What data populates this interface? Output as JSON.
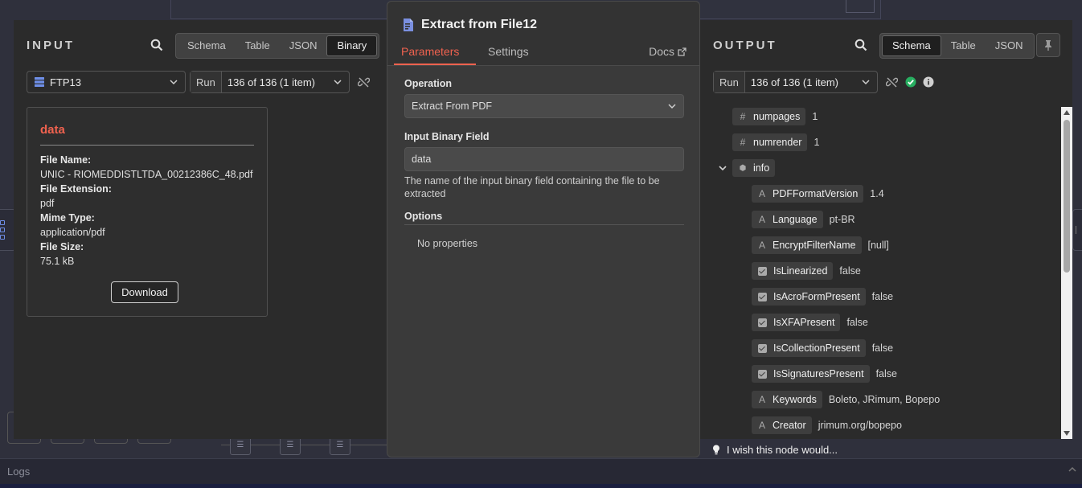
{
  "input": {
    "title": "INPUT",
    "view_tabs": [
      "Schema",
      "Table",
      "JSON",
      "Binary"
    ],
    "active_tab": "Binary",
    "source_node": "FTP13",
    "run_prefix": "Run",
    "run_select": "136 of 136 (1 item)",
    "binary": {
      "name": "data",
      "file_name_label": "File Name:",
      "file_name": "UNIC - RIOMEDDISTLTDA_00212386C_48.pdf",
      "file_extension_label": "File Extension:",
      "file_extension": "pdf",
      "mime_type_label": "Mime Type:",
      "mime_type": "application/pdf",
      "file_size_label": "File Size:",
      "file_size": "75.1 kB",
      "download_label": "Download"
    }
  },
  "node": {
    "title": "Extract from File12",
    "tabs": [
      "Parameters",
      "Settings"
    ],
    "active_tab": "Parameters",
    "docs_label": "Docs",
    "operation_label": "Operation",
    "operation_value": "Extract From PDF",
    "input_binary_label": "Input Binary Field",
    "input_binary_value": "data",
    "input_binary_hint": "The name of the input binary field containing the file to be extracted",
    "options_label": "Options",
    "no_properties": "No properties",
    "wish_text": "I wish this node would..."
  },
  "output": {
    "title": "OUTPUT",
    "view_tabs": [
      "Schema",
      "Table",
      "JSON"
    ],
    "active_tab": "Schema",
    "run_prefix": "Run",
    "run_select": "136 of 136 (1 item)",
    "rows": [
      {
        "type": "#",
        "key": "numpages",
        "value": "1",
        "level": 0
      },
      {
        "type": "#",
        "key": "numrender",
        "value": "1",
        "level": 0
      },
      {
        "type": "obj",
        "key": "info",
        "value": "",
        "level": 0
      },
      {
        "type": "A",
        "key": "PDFFormatVersion",
        "value": "1.4",
        "level": 1
      },
      {
        "type": "A",
        "key": "Language",
        "value": "pt-BR",
        "level": 1
      },
      {
        "type": "A",
        "key": "EncryptFilterName",
        "value": "[null]",
        "level": 1
      },
      {
        "type": "bool",
        "key": "IsLinearized",
        "value": "false",
        "level": 1
      },
      {
        "type": "bool",
        "key": "IsAcroFormPresent",
        "value": "false",
        "level": 1
      },
      {
        "type": "bool",
        "key": "IsXFAPresent",
        "value": "false",
        "level": 1
      },
      {
        "type": "bool",
        "key": "IsCollectionPresent",
        "value": "false",
        "level": 1
      },
      {
        "type": "bool",
        "key": "IsSignaturesPresent",
        "value": "false",
        "level": 1
      },
      {
        "type": "A",
        "key": "Keywords",
        "value": "Boleto, JRimum, Bopepo",
        "level": 1
      },
      {
        "type": "A",
        "key": "Creator",
        "value": "jrimum.org/bopepo",
        "level": 1
      }
    ]
  },
  "footer": {
    "logs_label": "Logs"
  },
  "colors": {
    "accent": "#f0624f",
    "success": "#27ae60",
    "node_icon": "#7a8fe0"
  }
}
